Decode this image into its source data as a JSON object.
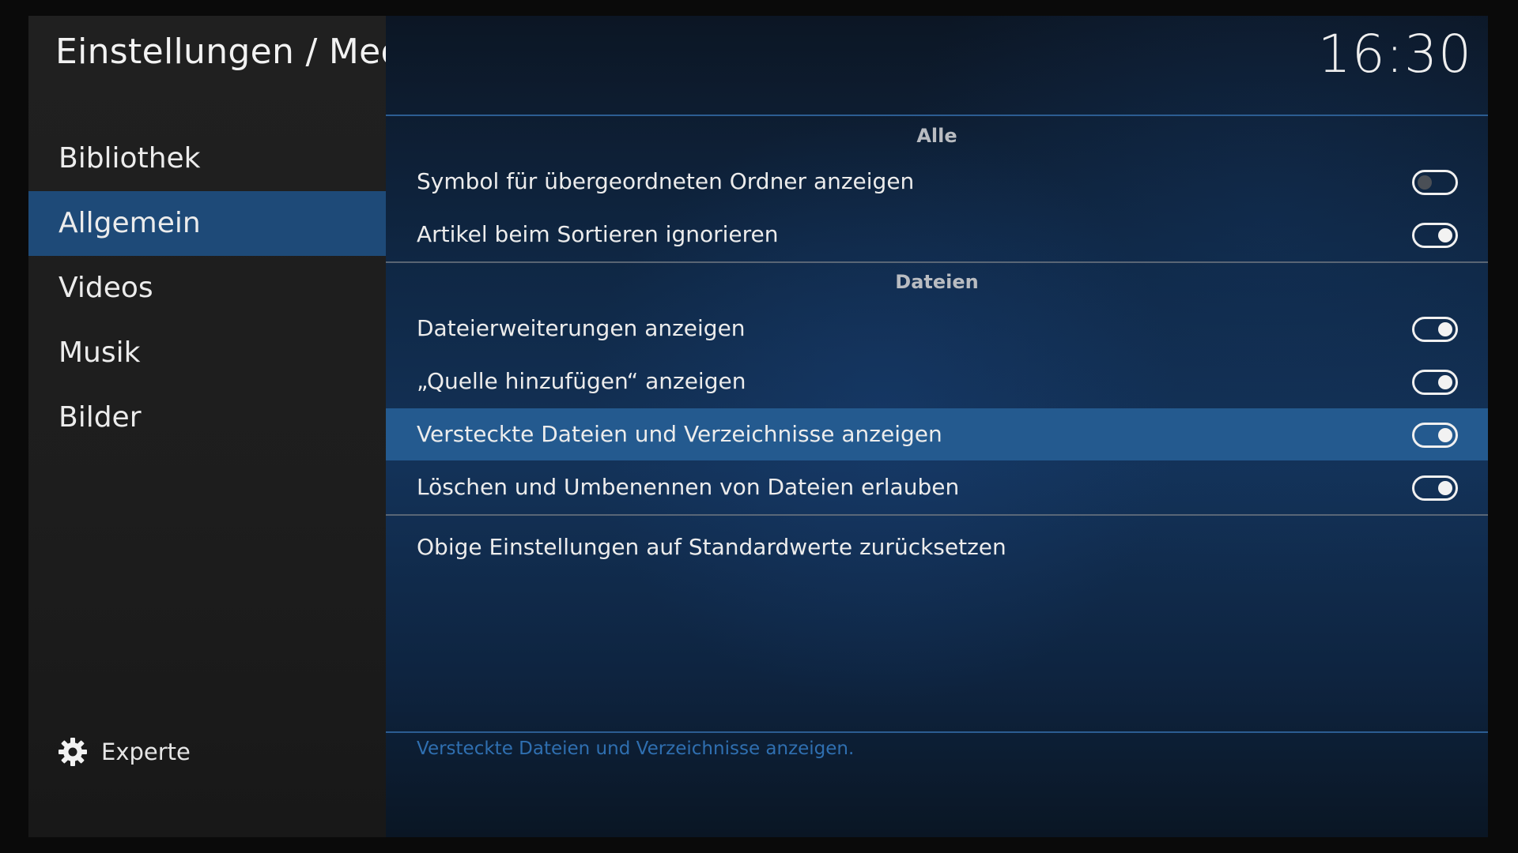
{
  "header": {
    "title": "Einstellungen / Medien",
    "clock": "16:30"
  },
  "sidebar": {
    "items": [
      {
        "label": "Bibliothek",
        "selected": false
      },
      {
        "label": "Allgemein",
        "selected": true
      },
      {
        "label": "Videos",
        "selected": false
      },
      {
        "label": "Musik",
        "selected": false
      },
      {
        "label": "Bilder",
        "selected": false
      }
    ],
    "footer": {
      "icon": "gear-icon",
      "label": "Experte"
    }
  },
  "sections": [
    {
      "header": "Alle",
      "settings": [
        {
          "label": "Symbol für übergeordneten Ordner anzeigen",
          "enabled": false
        },
        {
          "label": "Artikel beim Sortieren ignorieren",
          "enabled": true
        }
      ]
    },
    {
      "header": "Dateien",
      "settings": [
        {
          "label": "Dateierweiterungen anzeigen",
          "enabled": true
        },
        {
          "label": "„Quelle hinzufügen“ anzeigen",
          "enabled": true
        },
        {
          "label": "Versteckte Dateien und Verzeichnisse anzeigen",
          "enabled": true,
          "focused": true
        },
        {
          "label": "Löschen und Umbenennen von Dateien erlauben",
          "enabled": true
        }
      ]
    }
  ],
  "reset_label": "Obige Einstellungen auf Standardwerte zurücksetzen",
  "description": "Versteckte Dateien und Verzeichnisse anzeigen.",
  "colors": {
    "accent": "#245a8f",
    "sidebar_selected": "#1e4a78",
    "description_text": "#2f6fb0"
  }
}
